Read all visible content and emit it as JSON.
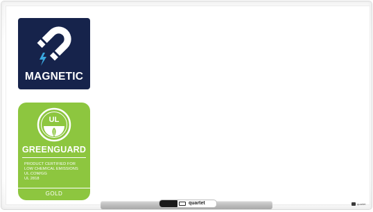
{
  "magnetic_badge": {
    "label": "MAGNETIC",
    "icon": "horseshoe-magnet-icon",
    "background": "#16234b",
    "accent": "#3aa8e0"
  },
  "greenguard_badge": {
    "logo_text": "UL",
    "icon": "ul-greenguard-leaf-icon",
    "title": "GREENGUARD",
    "lines": [
      "PRODUCT CERTIFIED FOR",
      "LOW CHEMICAL EMISSIONS",
      "UL.COM/GG",
      "UL 2818"
    ],
    "tier": "GOLD",
    "background": "#8dc63f"
  },
  "marker": {
    "brand": "quartet"
  },
  "corner_logo": {
    "text": "quartet"
  }
}
